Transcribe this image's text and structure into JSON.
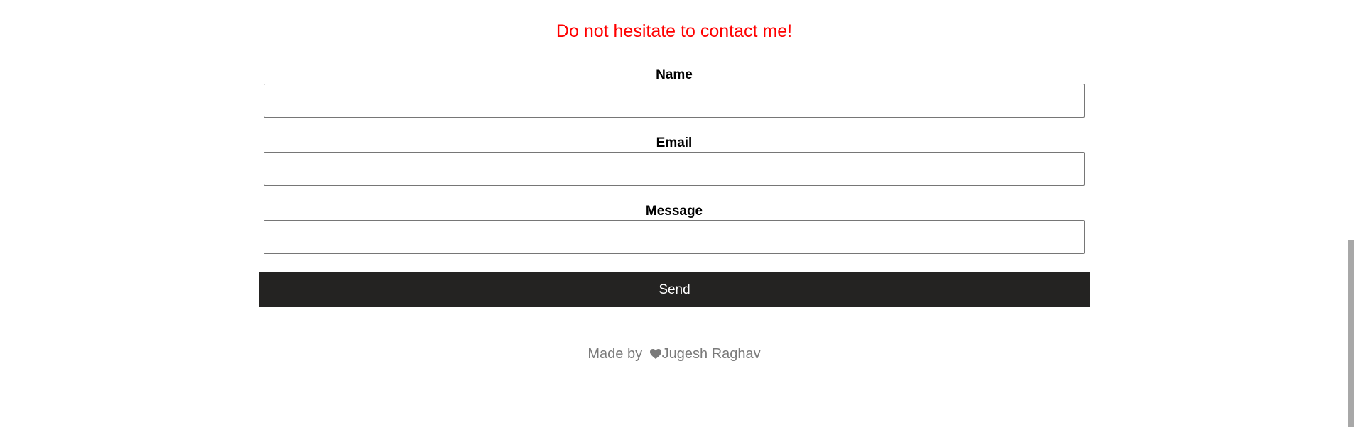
{
  "heading": "Do not hesitate to contact me!",
  "form": {
    "name_label": "Name",
    "email_label": "Email",
    "message_label": "Message",
    "send_label": "Send"
  },
  "footer": {
    "prefix": "Made by",
    "author": "Jugesh Raghav",
    "icon": "heart-icon"
  },
  "colors": {
    "heading": "#ff0000",
    "button_bg": "#242322",
    "footer_text": "#7a7a7a"
  }
}
